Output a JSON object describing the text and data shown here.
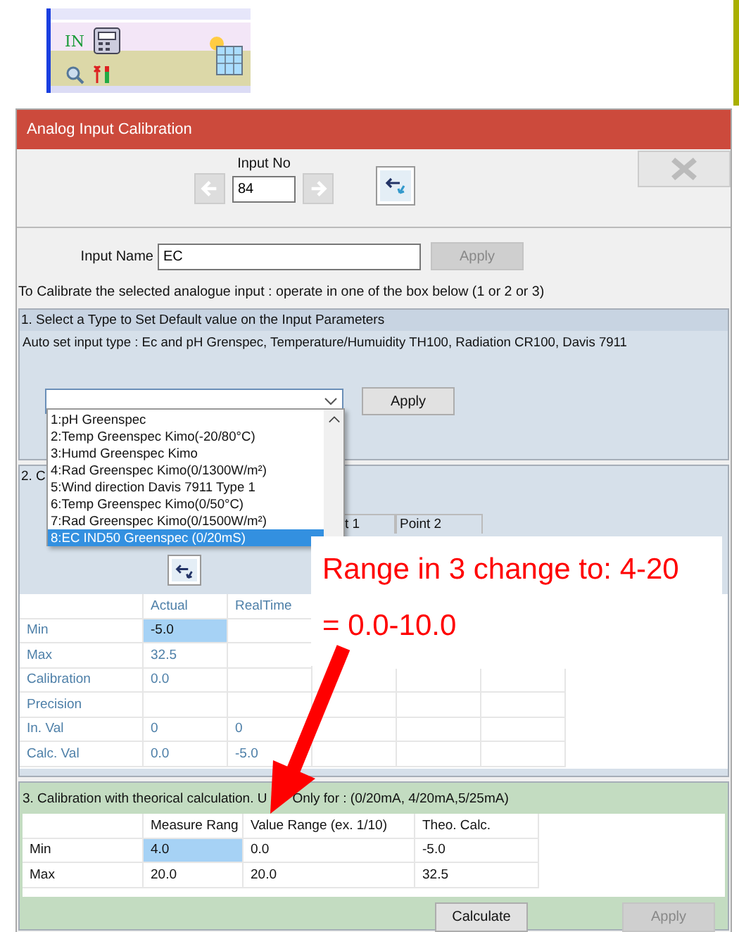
{
  "toolbar_crop": {
    "label": "IN"
  },
  "window": {
    "title": "Analog Input Calibration"
  },
  "input_no": {
    "label": "Input No",
    "value": "84"
  },
  "input_name": {
    "label": "Input Name",
    "value": "EC",
    "apply": {
      "label": "Apply",
      "disabled": true
    }
  },
  "instruction": "To Calibrate the selected analogue input : operate in one of the box below (1 or 2 or 3)",
  "section_1": {
    "title": "1. Select a Type to Set Default value on the Input Parameters",
    "auto_set": "Auto set input type :  Ec and pH Grenspec, Temperature/Humuidity TH100, Radiation CR100, Davis 7911",
    "apply": {
      "label": "Apply",
      "disabled": false
    },
    "dropdown_items": [
      {
        "text": "1:pH Greenspec",
        "selected": false
      },
      {
        "text": "2:Temp Greenspec Kimo(-20/80°C)",
        "selected": false
      },
      {
        "text": "3:Humd Greenspec Kimo",
        "selected": false
      },
      {
        "text": "4:Rad Greenspec Kimo(0/1300W/m²)",
        "selected": false
      },
      {
        "text": "5:Wind direction Davis 7911 Type 1",
        "selected": false
      },
      {
        "text": "6:Temp Greenspec Kimo(0/50°C)",
        "selected": false
      },
      {
        "text": "7:Rad Greenspec Kimo(0/1500W/m²)",
        "selected": false
      },
      {
        "text": "8:EC IND50 Greenspec (0/20mS)",
        "selected": true
      }
    ]
  },
  "section_2": {
    "title": "2. C",
    "point_headers": [
      "t 1",
      "Point 2"
    ],
    "columns": [
      "Actual",
      "RealTime"
    ],
    "rows": [
      {
        "label": "Min",
        "cells": [
          {
            "text": "-5.0",
            "selected": true
          },
          {
            "selected": false
          }
        ]
      },
      {
        "label": "Max",
        "cells": [
          {
            "text": "32.5",
            "selected": false
          },
          {
            "selected": false
          }
        ]
      },
      {
        "label": "Calibration",
        "cells": [
          {
            "text": "0.0",
            "selected": false
          },
          {
            "selected": false
          },
          {
            "selected": false
          },
          {
            "selected": false
          },
          {
            "selected": false
          }
        ]
      },
      {
        "label": "Precision",
        "cells": [
          {
            "selected": false
          },
          {
            "selected": false
          },
          {
            "selected": false
          },
          {
            "selected": false
          },
          {
            "selected": false
          }
        ]
      },
      {
        "label": "In. Val",
        "cells": [
          {
            "text": "0",
            "selected": false
          },
          {
            "text": "0",
            "selected": false
          },
          {
            "selected": false
          },
          {
            "selected": false
          },
          {
            "selected": false
          }
        ]
      },
      {
        "label": "Calc. Val",
        "cells": [
          {
            "text": "0.0",
            "selected": false
          },
          {
            "text": "-5.0",
            "selected": false
          },
          {
            "selected": false
          },
          {
            "selected": false
          },
          {
            "selected": false
          }
        ]
      }
    ]
  },
  "annotation": {
    "lines": [
      "Range in 3 change to: 4-20",
      "= 0.0-10.0"
    ]
  },
  "section_3": {
    "title_start": "3. Calibration with theorical calculation. U",
    "title_end": "Only for : (0/20mA, 4/20mA,5/25mA)",
    "columns": [
      "Measure Rang",
      "Value Range (ex. 1/10)",
      "Theo. Calc."
    ],
    "rows": [
      {
        "label": "Min",
        "cells": [
          {
            "text": "4.0",
            "selected": true
          },
          {
            "text": "0.0",
            "selected": false
          },
          {
            "text": "-5.0",
            "selected": false
          }
        ]
      },
      {
        "label": "Max",
        "cells": [
          {
            "text": "20.0",
            "selected": false
          },
          {
            "text": "20.0",
            "selected": false
          },
          {
            "text": "32.5",
            "selected": false
          }
        ]
      }
    ],
    "buttons": [
      {
        "label": "Calculate",
        "disabled": false
      },
      {
        "label": "Apply",
        "disabled": true
      }
    ]
  }
}
